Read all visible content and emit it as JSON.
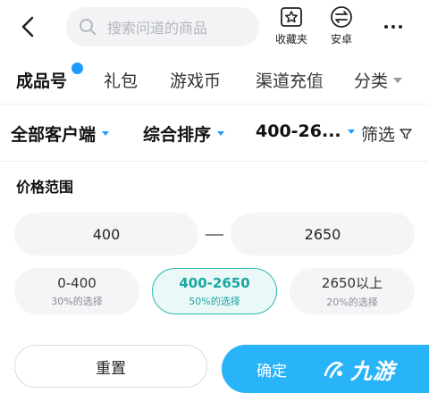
{
  "search": {
    "placeholder": "搜索问道的商品"
  },
  "top_actions": {
    "favorites_label": "收藏夹",
    "android_label": "安卓"
  },
  "tabs": [
    {
      "label": "成品号",
      "active": true
    },
    {
      "label": "礼包"
    },
    {
      "label": "游戏币"
    },
    {
      "label": "渠道充值"
    },
    {
      "label": "分类"
    }
  ],
  "filters": {
    "client": "全部客户端",
    "sort": "综合排序",
    "price": "400-26...",
    "screen": "筛选"
  },
  "price_range": {
    "title": "价格范围",
    "min": "400",
    "max": "2650",
    "options": [
      {
        "label": "0-400",
        "share": "30%的选择",
        "selected": false
      },
      {
        "label": "400-2650",
        "share": "50%的选择",
        "selected": true
      },
      {
        "label": "2650以上",
        "share": "20%的选择",
        "selected": false
      }
    ]
  },
  "buttons": {
    "reset": "重置",
    "confirm": "确定"
  },
  "watermark": {
    "text": "九游"
  },
  "colors": {
    "accent_blue": "#29b3f8",
    "selected_teal": "#2db7b0"
  }
}
